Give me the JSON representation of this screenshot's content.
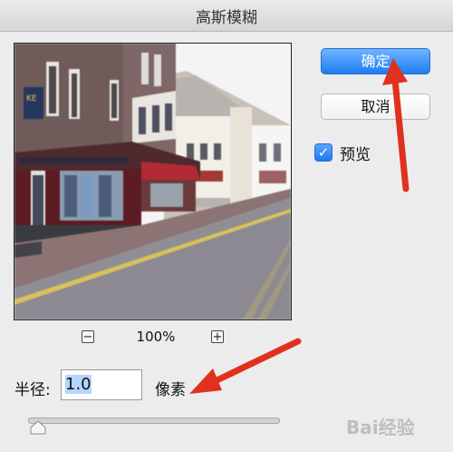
{
  "window": {
    "title": "高斯模糊"
  },
  "zoom": {
    "minus_icon": "minus-icon",
    "plus_icon": "plus-icon",
    "value": "100%"
  },
  "buttons": {
    "ok": "确定",
    "cancel": "取消"
  },
  "preview": {
    "label": "预览",
    "checked": true
  },
  "radius": {
    "label": "半径:",
    "value": "1.0",
    "unit": "像素"
  },
  "slider": {
    "value": 1.0
  },
  "colors": {
    "accent": "#1f7df2",
    "arrow": "#e0311f"
  },
  "watermark": {
    "text": "Bai经验"
  }
}
